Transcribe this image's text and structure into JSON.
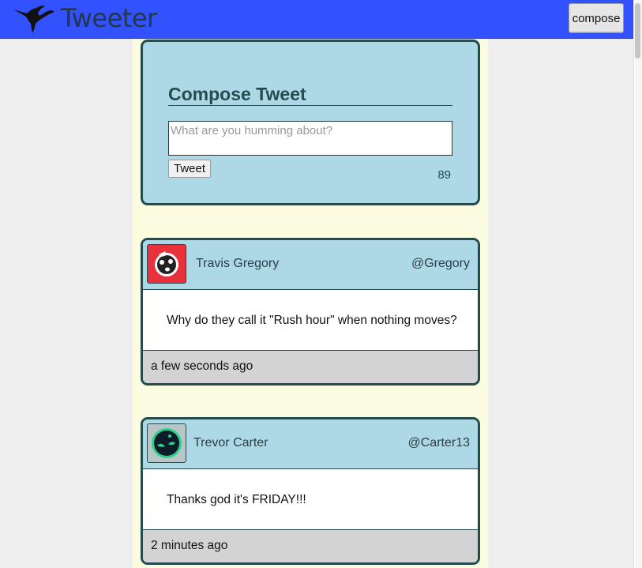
{
  "nav": {
    "brand": "Tweeter",
    "compose_label": "compose",
    "logo_icon": "hummingbird-icon"
  },
  "compose": {
    "title": "Compose Tweet",
    "placeholder": "What are you humming about?",
    "value": "",
    "submit_label": "Tweet",
    "counter": "89"
  },
  "tweets": [
    {
      "name": "Travis Gregory",
      "handle": "@Gregory",
      "text": "Why do they call it \"Rush hour\" when nothing moves?",
      "time": "a few seconds ago",
      "avatar_icon": "red-face-avatar-icon"
    },
    {
      "name": "Trevor Carter",
      "handle": "@Carter13",
      "text": "Thanks god it's FRIDAY!!!",
      "time": "2 minutes ago",
      "avatar_icon": "green-face-avatar-icon"
    }
  ],
  "colors": {
    "navbar": "#3352ff",
    "card": "#add8e6",
    "border": "#244b50",
    "page": "#fcfde0",
    "footer": "#d3d3d3"
  }
}
